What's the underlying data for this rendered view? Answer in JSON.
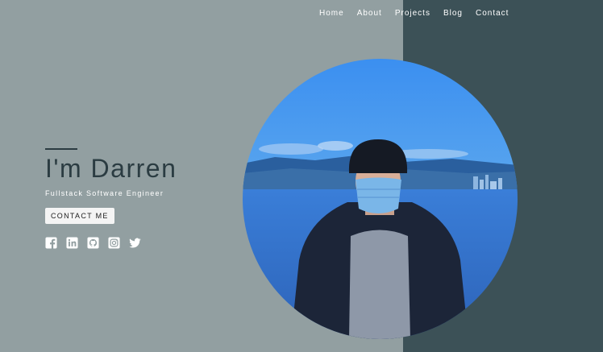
{
  "nav": {
    "items": [
      "Home",
      "About",
      "Projects",
      "Blog",
      "Contact"
    ]
  },
  "hero": {
    "name": "I'm Darren",
    "subtitle": "Fullstack Software Engineer",
    "cta_label": "CONTACT ME"
  },
  "socials": [
    "facebook-icon",
    "linkedin-icon",
    "github-icon",
    "instagram-icon",
    "twitter-icon"
  ],
  "colors": {
    "left_bg": "#929fa1",
    "right_bg": "#3c5157",
    "name_text": "#2b3c42",
    "photo_sky": "#3d8fe6"
  }
}
